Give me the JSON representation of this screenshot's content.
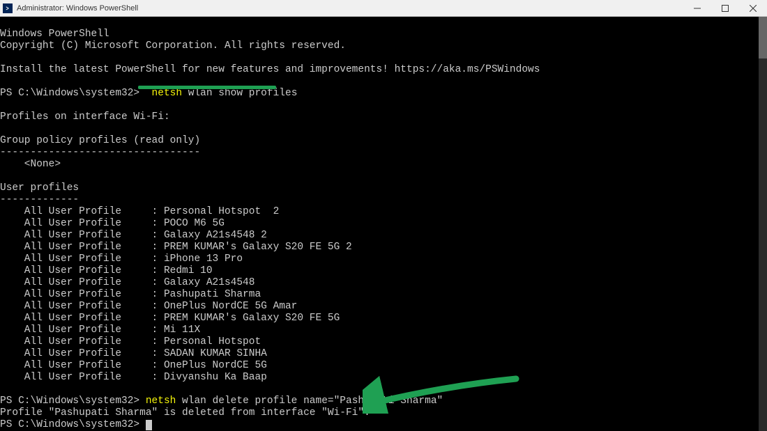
{
  "titlebar": {
    "title": "Administrator: Windows PowerShell"
  },
  "terminal": {
    "intro_line1": "Windows PowerShell",
    "intro_line2": "Copyright (C) Microsoft Corporation. All rights reserved.",
    "install_hint": "Install the latest PowerShell for new features and improvements! https://aka.ms/PSWindows",
    "prompt1": "PS C:\\Windows\\system32> ",
    "cmd1_head": "netsh",
    "cmd1_tail": " wlan show profiles",
    "profiles_header": "Profiles on interface Wi-Fi:",
    "group_policy_header": "Group policy profiles (read only)",
    "group_policy_divider": "---------------------------------",
    "group_policy_none": "    <None>",
    "user_profiles_header": "User profiles",
    "user_profiles_divider": "-------------",
    "profiles": [
      "    All User Profile     : Personal Hotspot  2",
      "    All User Profile     : POCO M6 5G",
      "    All User Profile     : Galaxy A21s4548 2",
      "    All User Profile     : PREM KUMAR's Galaxy S20 FE 5G 2",
      "    All User Profile     : iPhone 13 Pro",
      "    All User Profile     : Redmi 10",
      "    All User Profile     : Galaxy A21s4548",
      "    All User Profile     : Pashupati Sharma",
      "    All User Profile     : OnePlus NordCE 5G Amar",
      "    All User Profile     : PREM KUMAR's Galaxy S20 FE 5G",
      "    All User Profile     : Mi 11X",
      "    All User Profile     : Personal Hotspot",
      "    All User Profile     : SADAN KUMAR SINHA",
      "    All User Profile     : OnePlus NordCE 5G",
      "    All User Profile     : Divyanshu Ka Baap"
    ],
    "prompt2": "PS C:\\Windows\\system32> ",
    "cmd2_head": "netsh",
    "cmd2_tail": " wlan delete profile name=\"Pashupati Sharma\"",
    "delete_result": "Profile \"Pashupati Sharma\" is deleted from interface \"Wi-Fi\".",
    "prompt3": "PS C:\\Windows\\system32> "
  }
}
